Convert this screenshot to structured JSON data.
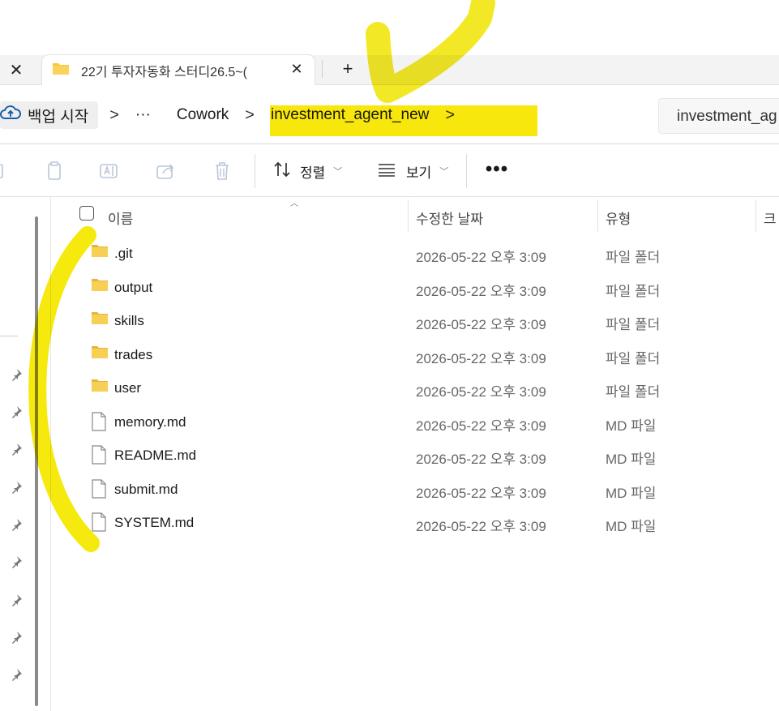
{
  "tabs": {
    "close_left_glyph": "✕",
    "active_tab": {
      "title": "22기 투자자동화 스터디26.5~(",
      "close_glyph": "✕"
    },
    "new_tab_glyph": "+"
  },
  "breadcrumb": {
    "home": "백업 시작",
    "ellipsis": "···",
    "cowork": "Cowork",
    "current": "investment_agent_new",
    "chevron": ">",
    "search_text": "investment_ag"
  },
  "toolbar": {
    "sort_label": "정렬",
    "view_label": "보기",
    "more_glyph": "•••",
    "icons": [
      "cut-icon",
      "copy-icon",
      "paste-icon",
      "rename-icon",
      "share-icon",
      "delete-icon"
    ]
  },
  "columns": {
    "name": "이름",
    "modified": "수정한 날짜",
    "type": "유형",
    "size": "크"
  },
  "files": [
    {
      "name": ".git",
      "date": "2026-05-22 오후 3:09",
      "type": "파일 폴더",
      "kind": "folder"
    },
    {
      "name": "output",
      "date": "2026-05-22 오후 3:09",
      "type": "파일 폴더",
      "kind": "folder"
    },
    {
      "name": "skills",
      "date": "2026-05-22 오후 3:09",
      "type": "파일 폴더",
      "kind": "folder"
    },
    {
      "name": "trades",
      "date": "2026-05-22 오후 3:09",
      "type": "파일 폴더",
      "kind": "folder"
    },
    {
      "name": "user",
      "date": "2026-05-22 오후 3:09",
      "type": "파일 폴더",
      "kind": "folder"
    },
    {
      "name": "memory.md",
      "date": "2026-05-22 오후 3:09",
      "type": "MD 파일",
      "kind": "file"
    },
    {
      "name": "README.md",
      "date": "2026-05-22 오후 3:09",
      "type": "MD 파일",
      "kind": "file"
    },
    {
      "name": "submit.md",
      "date": "2026-05-22 오후 3:09",
      "type": "MD 파일",
      "kind": "file"
    },
    {
      "name": "SYSTEM.md",
      "date": "2026-05-22 오후 3:09",
      "type": "MD 파일",
      "kind": "file"
    }
  ],
  "colors": {
    "highlight": "#f7e600",
    "folder": "#f5c842",
    "accent": "#1a73c8"
  }
}
